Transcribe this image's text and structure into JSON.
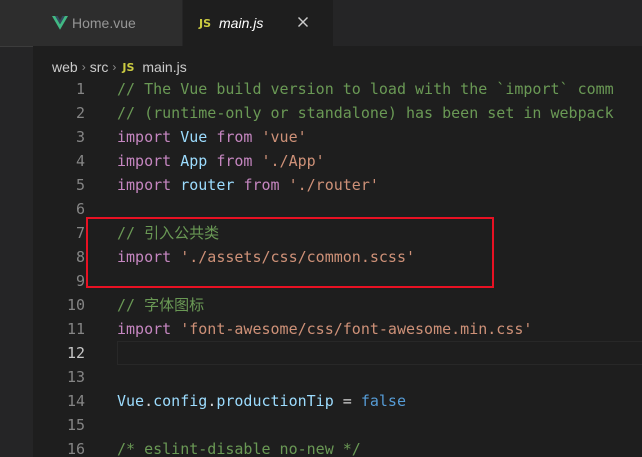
{
  "tabs": [
    {
      "label": "Home.vue",
      "icon": "vue-icon"
    },
    {
      "label": "main.js",
      "icon": "js-icon",
      "active": true
    }
  ],
  "js_badge": "JS",
  "breadcrumb": {
    "folder1": "web",
    "folder2": "src",
    "file": "main.js"
  },
  "editor": {
    "current_line": 12,
    "lines": [
      {
        "n": "1",
        "tokens": [
          {
            "t": "// The Vue build version to load with the `import` comm",
            "c": "comment"
          }
        ]
      },
      {
        "n": "2",
        "tokens": [
          {
            "t": "// (runtime-only or standalone) has been set in webpack",
            "c": "comment"
          }
        ]
      },
      {
        "n": "3",
        "tokens": [
          {
            "t": "import",
            "c": "kw"
          },
          {
            "t": " ",
            "c": "plain"
          },
          {
            "t": "Vue",
            "c": "id"
          },
          {
            "t": " ",
            "c": "plain"
          },
          {
            "t": "from",
            "c": "kw"
          },
          {
            "t": " ",
            "c": "plain"
          },
          {
            "t": "'vue'",
            "c": "str"
          }
        ]
      },
      {
        "n": "4",
        "tokens": [
          {
            "t": "import",
            "c": "kw"
          },
          {
            "t": " ",
            "c": "plain"
          },
          {
            "t": "App",
            "c": "id"
          },
          {
            "t": " ",
            "c": "plain"
          },
          {
            "t": "from",
            "c": "kw"
          },
          {
            "t": " ",
            "c": "plain"
          },
          {
            "t": "'./App'",
            "c": "str"
          }
        ]
      },
      {
        "n": "5",
        "tokens": [
          {
            "t": "import",
            "c": "kw"
          },
          {
            "t": " ",
            "c": "plain"
          },
          {
            "t": "router",
            "c": "id"
          },
          {
            "t": " ",
            "c": "plain"
          },
          {
            "t": "from",
            "c": "kw"
          },
          {
            "t": " ",
            "c": "plain"
          },
          {
            "t": "'./router'",
            "c": "str"
          }
        ]
      },
      {
        "n": "6",
        "tokens": []
      },
      {
        "n": "7",
        "tokens": [
          {
            "t": "// 引入公共类",
            "c": "comment"
          }
        ]
      },
      {
        "n": "8",
        "tokens": [
          {
            "t": "import",
            "c": "kw"
          },
          {
            "t": " ",
            "c": "plain"
          },
          {
            "t": "'./assets/css/common.scss'",
            "c": "str"
          }
        ]
      },
      {
        "n": "9",
        "tokens": []
      },
      {
        "n": "10",
        "tokens": [
          {
            "t": "// 字体图标",
            "c": "comment"
          }
        ]
      },
      {
        "n": "11",
        "tokens": [
          {
            "t": "import",
            "c": "kw"
          },
          {
            "t": " ",
            "c": "plain"
          },
          {
            "t": "'font-awesome/css/font-awesome.min.css'",
            "c": "str"
          }
        ]
      },
      {
        "n": "12",
        "tokens": []
      },
      {
        "n": "13",
        "tokens": []
      },
      {
        "n": "14",
        "tokens": [
          {
            "t": "Vue",
            "c": "id"
          },
          {
            "t": ".",
            "c": "plain"
          },
          {
            "t": "config",
            "c": "id"
          },
          {
            "t": ".",
            "c": "plain"
          },
          {
            "t": "productionTip",
            "c": "id"
          },
          {
            "t": " = ",
            "c": "plain"
          },
          {
            "t": "false",
            "c": "bool"
          }
        ]
      },
      {
        "n": "15",
        "tokens": []
      },
      {
        "n": "16",
        "tokens": [
          {
            "t": "/* eslint-disable no-new */",
            "c": "comment"
          }
        ]
      }
    ]
  }
}
